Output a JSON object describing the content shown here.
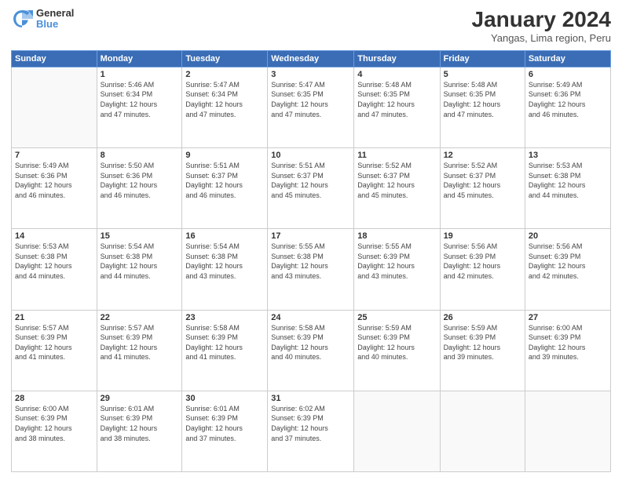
{
  "header": {
    "logo_general": "General",
    "logo_blue": "Blue",
    "month_title": "January 2024",
    "location": "Yangas, Lima region, Peru"
  },
  "weekdays": [
    "Sunday",
    "Monday",
    "Tuesday",
    "Wednesday",
    "Thursday",
    "Friday",
    "Saturday"
  ],
  "weeks": [
    [
      {
        "day": "",
        "info": ""
      },
      {
        "day": "1",
        "info": "Sunrise: 5:46 AM\nSunset: 6:34 PM\nDaylight: 12 hours\nand 47 minutes."
      },
      {
        "day": "2",
        "info": "Sunrise: 5:47 AM\nSunset: 6:34 PM\nDaylight: 12 hours\nand 47 minutes."
      },
      {
        "day": "3",
        "info": "Sunrise: 5:47 AM\nSunset: 6:35 PM\nDaylight: 12 hours\nand 47 minutes."
      },
      {
        "day": "4",
        "info": "Sunrise: 5:48 AM\nSunset: 6:35 PM\nDaylight: 12 hours\nand 47 minutes."
      },
      {
        "day": "5",
        "info": "Sunrise: 5:48 AM\nSunset: 6:35 PM\nDaylight: 12 hours\nand 47 minutes."
      },
      {
        "day": "6",
        "info": "Sunrise: 5:49 AM\nSunset: 6:36 PM\nDaylight: 12 hours\nand 46 minutes."
      }
    ],
    [
      {
        "day": "7",
        "info": "Sunrise: 5:49 AM\nSunset: 6:36 PM\nDaylight: 12 hours\nand 46 minutes."
      },
      {
        "day": "8",
        "info": "Sunrise: 5:50 AM\nSunset: 6:36 PM\nDaylight: 12 hours\nand 46 minutes."
      },
      {
        "day": "9",
        "info": "Sunrise: 5:51 AM\nSunset: 6:37 PM\nDaylight: 12 hours\nand 46 minutes."
      },
      {
        "day": "10",
        "info": "Sunrise: 5:51 AM\nSunset: 6:37 PM\nDaylight: 12 hours\nand 45 minutes."
      },
      {
        "day": "11",
        "info": "Sunrise: 5:52 AM\nSunset: 6:37 PM\nDaylight: 12 hours\nand 45 minutes."
      },
      {
        "day": "12",
        "info": "Sunrise: 5:52 AM\nSunset: 6:37 PM\nDaylight: 12 hours\nand 45 minutes."
      },
      {
        "day": "13",
        "info": "Sunrise: 5:53 AM\nSunset: 6:38 PM\nDaylight: 12 hours\nand 44 minutes."
      }
    ],
    [
      {
        "day": "14",
        "info": "Sunrise: 5:53 AM\nSunset: 6:38 PM\nDaylight: 12 hours\nand 44 minutes."
      },
      {
        "day": "15",
        "info": "Sunrise: 5:54 AM\nSunset: 6:38 PM\nDaylight: 12 hours\nand 44 minutes."
      },
      {
        "day": "16",
        "info": "Sunrise: 5:54 AM\nSunset: 6:38 PM\nDaylight: 12 hours\nand 43 minutes."
      },
      {
        "day": "17",
        "info": "Sunrise: 5:55 AM\nSunset: 6:38 PM\nDaylight: 12 hours\nand 43 minutes."
      },
      {
        "day": "18",
        "info": "Sunrise: 5:55 AM\nSunset: 6:39 PM\nDaylight: 12 hours\nand 43 minutes."
      },
      {
        "day": "19",
        "info": "Sunrise: 5:56 AM\nSunset: 6:39 PM\nDaylight: 12 hours\nand 42 minutes."
      },
      {
        "day": "20",
        "info": "Sunrise: 5:56 AM\nSunset: 6:39 PM\nDaylight: 12 hours\nand 42 minutes."
      }
    ],
    [
      {
        "day": "21",
        "info": "Sunrise: 5:57 AM\nSunset: 6:39 PM\nDaylight: 12 hours\nand 41 minutes."
      },
      {
        "day": "22",
        "info": "Sunrise: 5:57 AM\nSunset: 6:39 PM\nDaylight: 12 hours\nand 41 minutes."
      },
      {
        "day": "23",
        "info": "Sunrise: 5:58 AM\nSunset: 6:39 PM\nDaylight: 12 hours\nand 41 minutes."
      },
      {
        "day": "24",
        "info": "Sunrise: 5:58 AM\nSunset: 6:39 PM\nDaylight: 12 hours\nand 40 minutes."
      },
      {
        "day": "25",
        "info": "Sunrise: 5:59 AM\nSunset: 6:39 PM\nDaylight: 12 hours\nand 40 minutes."
      },
      {
        "day": "26",
        "info": "Sunrise: 5:59 AM\nSunset: 6:39 PM\nDaylight: 12 hours\nand 39 minutes."
      },
      {
        "day": "27",
        "info": "Sunrise: 6:00 AM\nSunset: 6:39 PM\nDaylight: 12 hours\nand 39 minutes."
      }
    ],
    [
      {
        "day": "28",
        "info": "Sunrise: 6:00 AM\nSunset: 6:39 PM\nDaylight: 12 hours\nand 38 minutes."
      },
      {
        "day": "29",
        "info": "Sunrise: 6:01 AM\nSunset: 6:39 PM\nDaylight: 12 hours\nand 38 minutes."
      },
      {
        "day": "30",
        "info": "Sunrise: 6:01 AM\nSunset: 6:39 PM\nDaylight: 12 hours\nand 37 minutes."
      },
      {
        "day": "31",
        "info": "Sunrise: 6:02 AM\nSunset: 6:39 PM\nDaylight: 12 hours\nand 37 minutes."
      },
      {
        "day": "",
        "info": ""
      },
      {
        "day": "",
        "info": ""
      },
      {
        "day": "",
        "info": ""
      }
    ]
  ]
}
